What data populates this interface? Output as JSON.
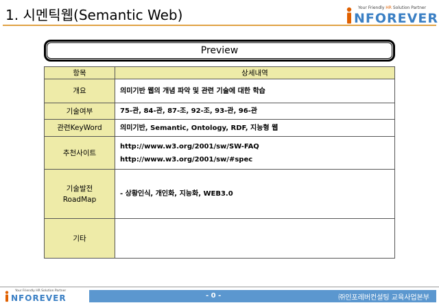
{
  "slide": {
    "title": "1. 시멘틱웹(Semantic Web)"
  },
  "logo": {
    "tagline_pre": "Your Friendly ",
    "tagline_hr": "HR",
    "tagline_post": " Solution Partner",
    "wordmark": "NFOREVER",
    "brand_blue": "#3a7fc4",
    "brand_orange": "#e06000"
  },
  "preview": {
    "label": "Preview"
  },
  "table": {
    "headers": [
      "항목",
      "상세내역"
    ],
    "rows": [
      {
        "key": "개요",
        "value": "의미기반 웹의 개념 파악 및 관련 기술에 대한 학습"
      },
      {
        "key": "기술여부",
        "value": "75-관, 84-관, 87-조, 92-조, 93-관, 96-관"
      },
      {
        "key": "관련KeyWord",
        "value": "의미기반, Semantic, Ontology, RDF, 지능형 웹"
      },
      {
        "key": "추천사이트",
        "value_lines": [
          "http://www.w3.org/2001/sw/SW-FAQ",
          "http://www.w3.org/2001/sw/#spec"
        ]
      },
      {
        "key_lines": [
          "기술발전",
          "RoadMap"
        ],
        "value": "- 상황인식, 개인화, 지능화, WEB3.0"
      },
      {
        "key": "기타",
        "value": ""
      }
    ],
    "header_bg": "#eeeba8"
  },
  "footer": {
    "page": "- 0 -",
    "company": "㈜인포레버컨설팅 교육사업본부",
    "logo_tagline": "Your Friendly HR Solution Partner",
    "logo_wordmark": "NFOREVER",
    "bar_color": "#5b97cf"
  }
}
